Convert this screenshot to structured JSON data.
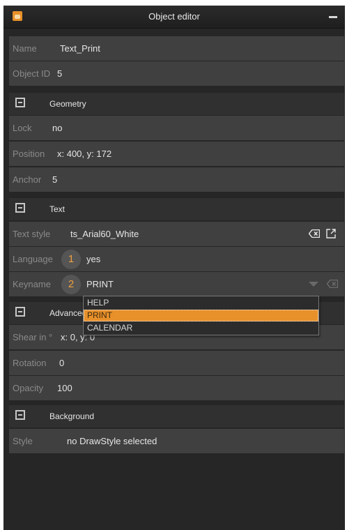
{
  "window": {
    "title": "Object editor"
  },
  "fields": {
    "name": {
      "label": "Name",
      "value": "Text_Print"
    },
    "object_id": {
      "label": "Object ID",
      "value": "5"
    }
  },
  "geometry": {
    "title": "Geometry",
    "lock": {
      "label": "Lock",
      "value": "no"
    },
    "position": {
      "label": "Position",
      "value": "x: 400,  y: 172"
    },
    "anchor": {
      "label": "Anchor",
      "value": "5"
    }
  },
  "text": {
    "title": "Text",
    "text_style": {
      "label": "Text style",
      "value": "ts_Arial60_White"
    },
    "language": {
      "label": "Language",
      "badge": "1",
      "value": "yes"
    },
    "keyname": {
      "label": "Keyname",
      "badge": "2",
      "value": "PRINT",
      "options": [
        "HELP",
        "PRINT",
        "CALENDAR"
      ],
      "selected_index": 1
    }
  },
  "advanced": {
    "title": "Advanced",
    "shear": {
      "label": "Shear in °",
      "value": "x: 0,  y: 0"
    },
    "rotation": {
      "label": "Rotation",
      "value": "0"
    },
    "opacity": {
      "label": "Opacity",
      "value": "100"
    }
  },
  "background": {
    "title": "Background",
    "style": {
      "label": "Style",
      "value": "no DrawStyle selected"
    }
  },
  "colors": {
    "accent": "#e8902a",
    "panel": "#262626",
    "row": "#404040",
    "section": "#303030"
  }
}
